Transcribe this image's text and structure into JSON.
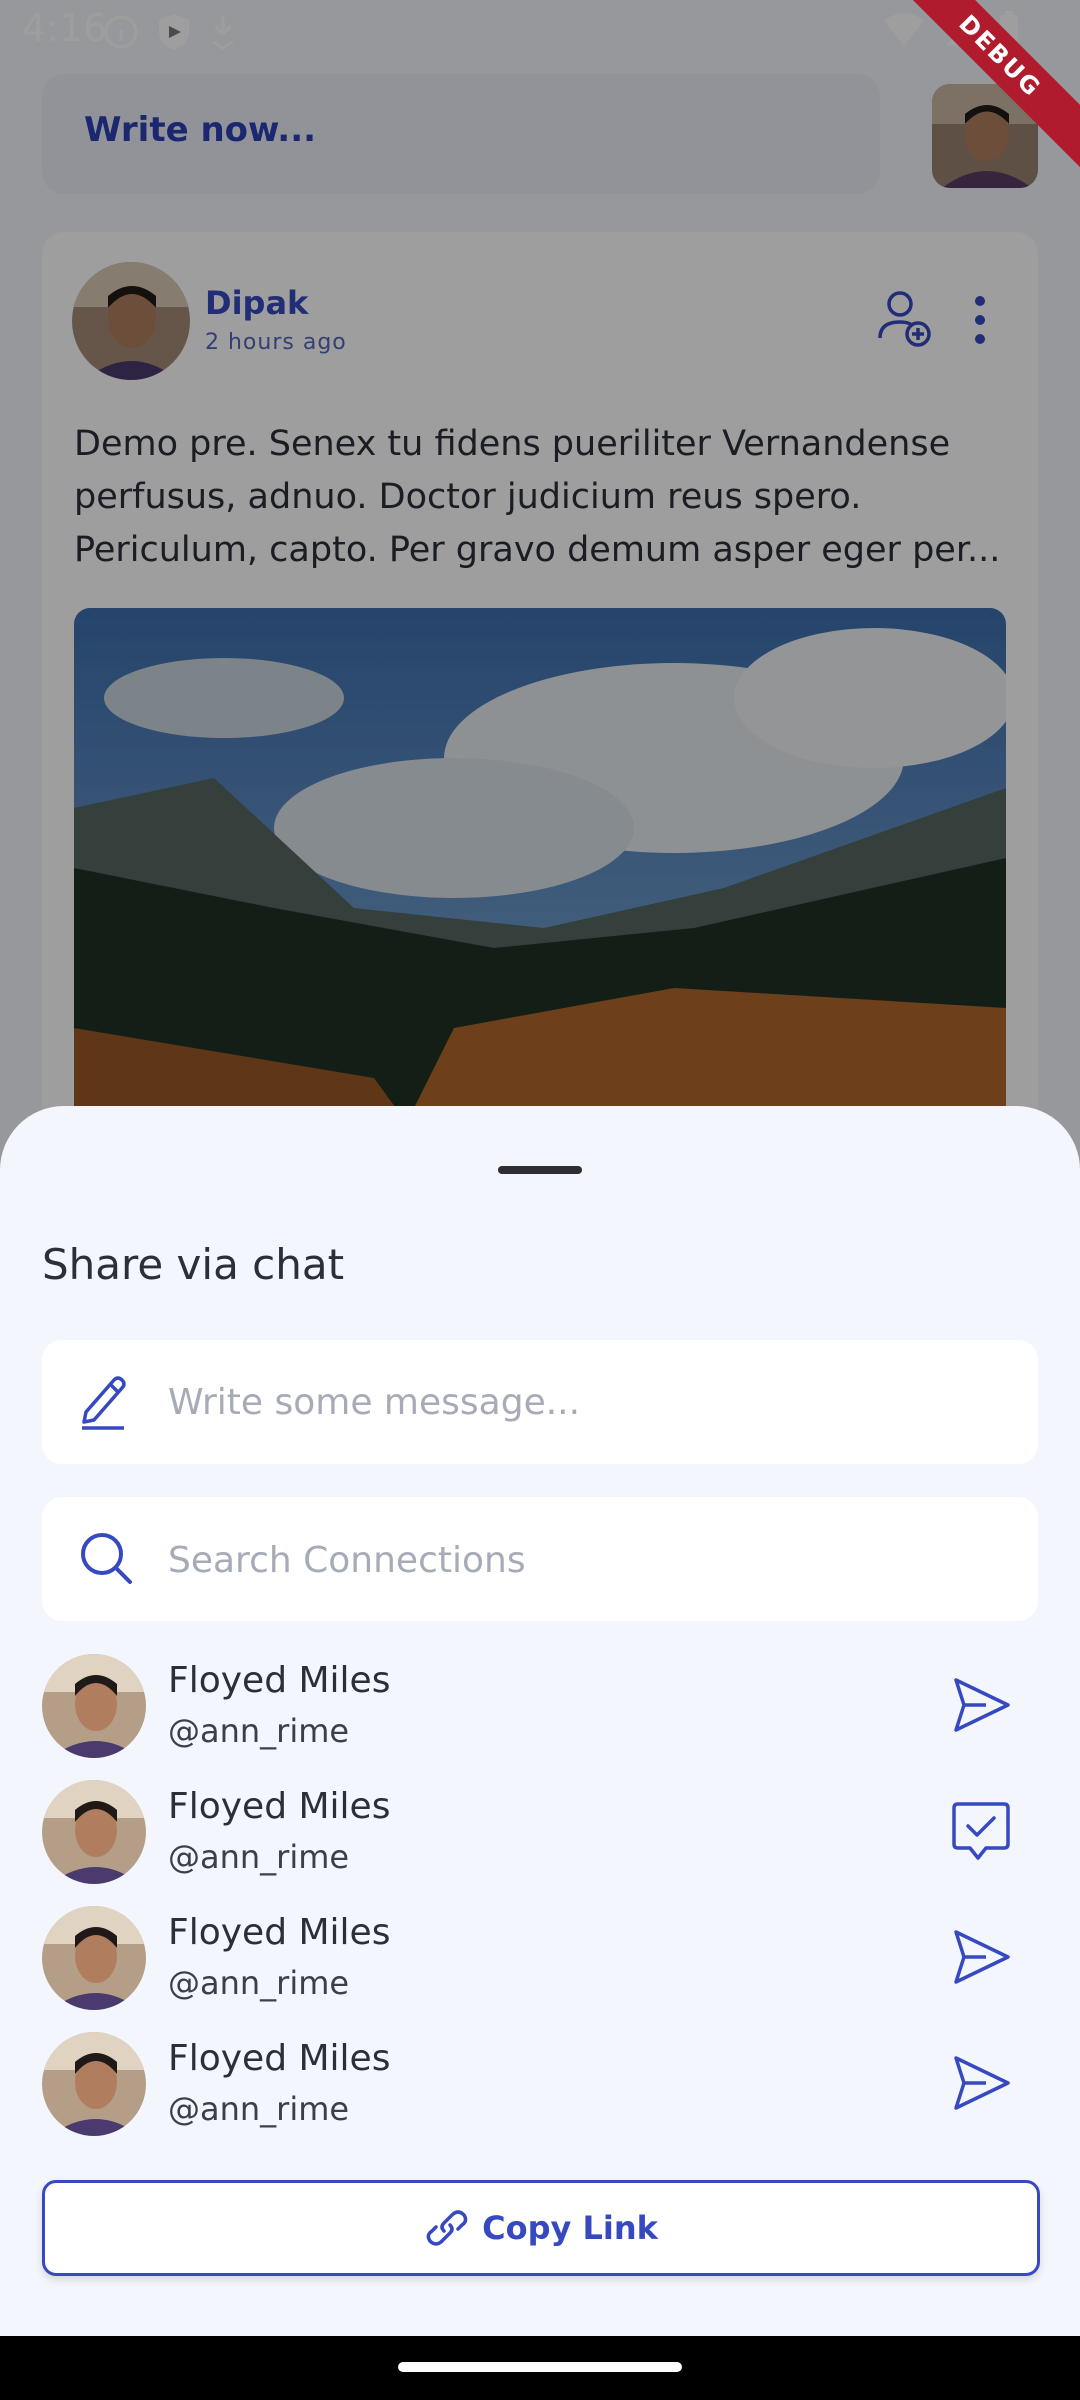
{
  "status_bar": {
    "time": "4:16",
    "debug_ribbon": "DEBUG"
  },
  "composer": {
    "write_label": "Write now..."
  },
  "post": {
    "author": "Dipak",
    "time_ago": "2 hours ago",
    "body": "Demo pre. Senex tu fidens pueriliter Vernandense perfusus, adnuo. Doctor judicium reus spero. Periculum, capto. Per gravo demum asper eger per..."
  },
  "share_sheet": {
    "title": "Share via chat",
    "message_placeholder": "Write some message...",
    "search_placeholder": "Search Connections",
    "connections": [
      {
        "name": "Floyed Miles",
        "handle": "@ann_rime",
        "action_icon": "send-icon"
      },
      {
        "name": "Floyed Miles",
        "handle": "@ann_rime",
        "action_icon": "sent-check-icon"
      },
      {
        "name": "Floyed Miles",
        "handle": "@ann_rime",
        "action_icon": "send-icon"
      },
      {
        "name": "Floyed Miles",
        "handle": "@ann_rime",
        "action_icon": "send-icon"
      }
    ],
    "copy_link_label": "Copy Link"
  },
  "colors": {
    "accent": "#3649c0",
    "sheet_bg": "#f3f6fc",
    "debug_ribbon": "#b01c2e"
  }
}
